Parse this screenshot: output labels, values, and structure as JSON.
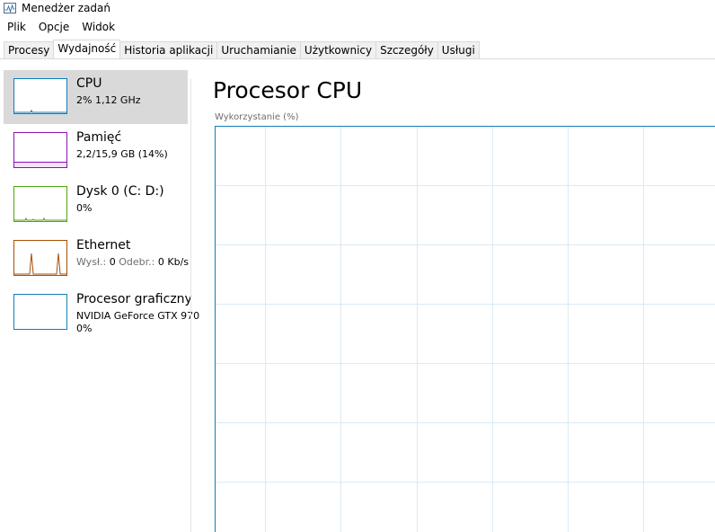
{
  "window": {
    "title": "Menedżer zadań",
    "icon": "task-manager-icon"
  },
  "menu": [
    "Plik",
    "Opcje",
    "Widok"
  ],
  "tabs": [
    "Procesy",
    "Wydajność",
    "Historia aplikacji",
    "Uruchamianie",
    "Użytkownicy",
    "Szczegóły",
    "Usługi"
  ],
  "active_tab": "Wydajność",
  "sidebar": [
    {
      "name": "CPU",
      "line1": "2% 1,12 GHz",
      "color": "#117dbb",
      "selected": true
    },
    {
      "name": "Pamięć",
      "line1": "2,2/15,9 GB (14%)",
      "color": "#8b12ae"
    },
    {
      "name": "Dysk 0 (C: D:)",
      "line1": "0%",
      "color": "#4da60c"
    },
    {
      "name": "Ethernet",
      "send_label": "Wysł.:",
      "send_value": "0",
      "recv_label": "Odebr.:",
      "recv_value": "0 Kb/s",
      "color": "#a74f01"
    },
    {
      "name": "Procesor graficzny",
      "line1": "NVIDIA GeForce GTX 970",
      "line2": "0%",
      "color": "#117dbb"
    }
  ],
  "main": {
    "title": "Procesor CPU",
    "graph_label": "Wykorzystanie (%)"
  },
  "colors": {
    "cpu_border": "#117dbb",
    "grid": "#d9eaf4",
    "selected_bg": "#d9d9d9"
  }
}
